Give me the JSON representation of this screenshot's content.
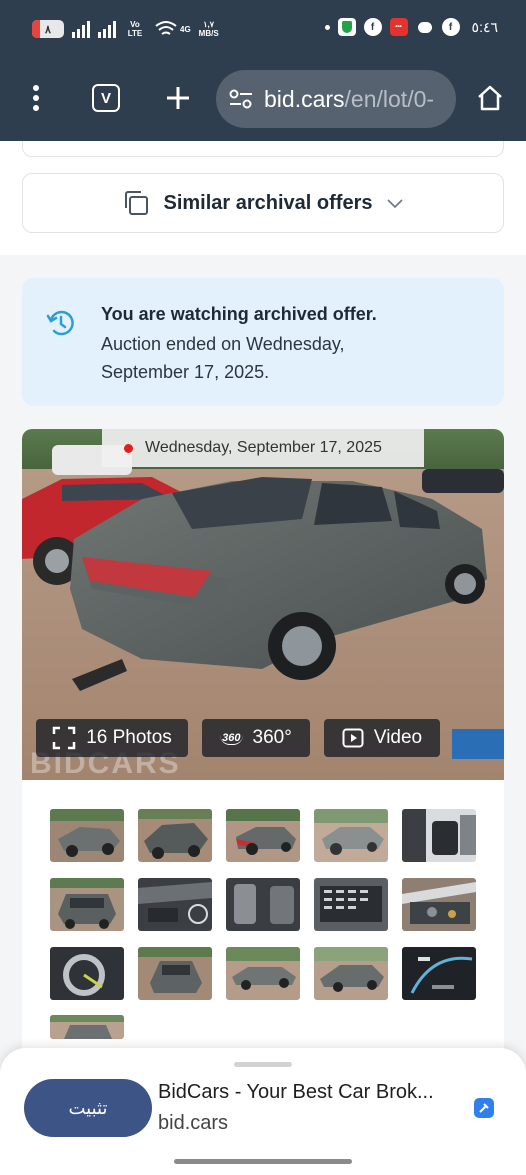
{
  "status_bar": {
    "battery": "٨",
    "network_label": "Vo LTE",
    "network_type": "4G",
    "speed_value": "١,٧",
    "speed_unit": "MB/S",
    "time": "٥:٤٦"
  },
  "browser": {
    "url_host": "bid.cars",
    "url_path": "/en/lot/0-",
    "tab_letter": "V"
  },
  "similar": {
    "label": "Similar archival offers"
  },
  "notice": {
    "title": "You are watching archived offer.",
    "line1": "Auction ended on Wednesday,",
    "line2": "September 17, 2025."
  },
  "gallery": {
    "auction_date": "Wednesday, September 17, 2025",
    "photos_label": "16 Photos",
    "spin_label": "360°",
    "spin_icon_text": "360",
    "video_label": "Video",
    "watermark": "BIDCARS",
    "thumbnail_count": 16
  },
  "install_sheet": {
    "button_label": "تثبيت",
    "app_title": "BidCars - Your Best Car Brok...",
    "app_host": "bid.cars"
  },
  "colors": {
    "chrome": "#2f3e4f",
    "install_button": "#3d5487",
    "notice_bg": "#e2f1fb",
    "accent_icon": "#2a9fd6"
  }
}
